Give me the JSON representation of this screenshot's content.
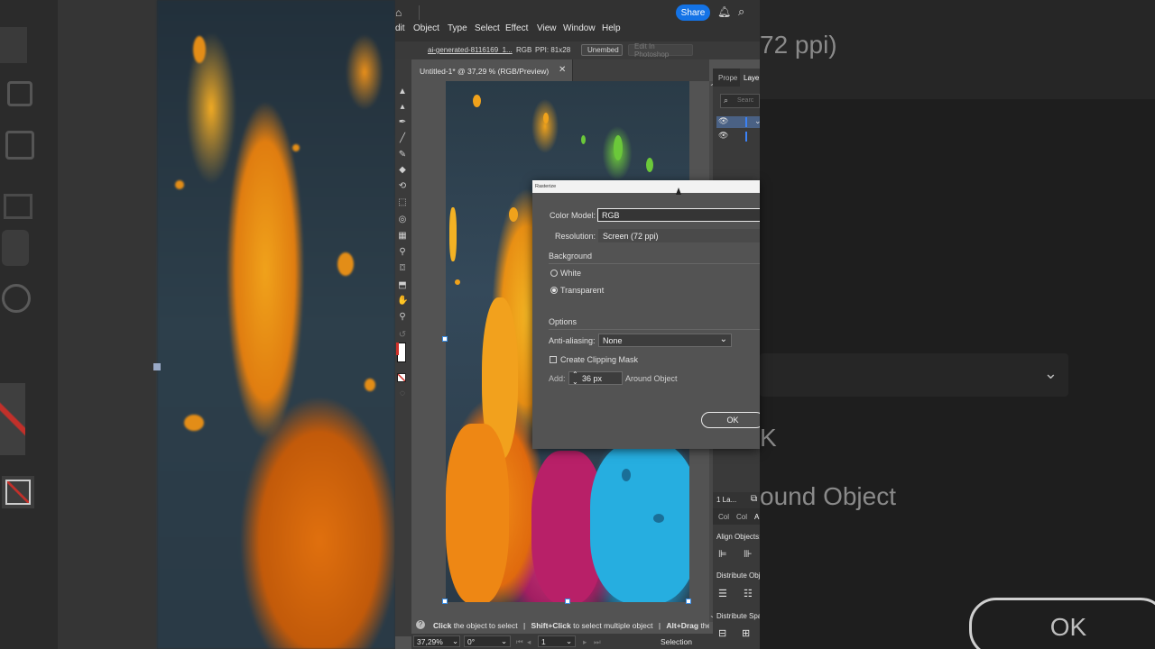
{
  "menu": {
    "items": [
      "dit",
      "Object",
      "Type",
      "Select",
      "Effect",
      "View",
      "Window",
      "Help"
    ],
    "share_label": "Share"
  },
  "control_bar": {
    "file_name": "ai-generated-8116169_1...",
    "color_mode": "RGB",
    "ppi": "PPI: 81x28",
    "unembed_label": "Unembed",
    "edit_photoshop_label": "Edit In Photoshop"
  },
  "document_tab": {
    "title": "Untitled-1* @ 37,29 % (RGB/Preview)",
    "close_glyph": "✕"
  },
  "status_hint": {
    "click": "Click",
    "click_rest": " the object to select",
    "sep1": "|",
    "shift": "Shift+Click",
    "shift_rest": " to select multiple object",
    "sep2": "|",
    "alt": "Alt+Drag",
    "alt_rest": " the obje"
  },
  "bottom_bar": {
    "zoom": "37,29%",
    "rotation": "0°",
    "artboard_number": "1",
    "tool_name": "Selection"
  },
  "right_panel": {
    "tab_properties": "Prope",
    "tab_layers": "Laye",
    "search_placeholder": "Searc",
    "layers_count": "1 La...",
    "subtab1": "Col",
    "subtab2": "Col",
    "subtab3": "A",
    "align_objects": "Align Objects:",
    "distribute_objects": "Distribute Obje",
    "distribute_spacing": "Distribute Spac"
  },
  "dialog": {
    "title": "Rasterize",
    "color_model_label": "Color Model:",
    "color_model_value": "RGB",
    "resolution_label": "Resolution:",
    "resolution_value": "Screen (72 ppi)",
    "background_heading": "Background",
    "white_label": "White",
    "transparent_label": "Transparent",
    "selected_background": "Transparent",
    "options_heading": "Options",
    "anti_aliasing_label": "Anti-aliasing:",
    "anti_aliasing_value": "None",
    "clipping_mask_label": "Create Clipping Mask",
    "clipping_mask_checked": false,
    "add_label": "Add:",
    "add_value": "36 px",
    "around_object_label": "Around Object",
    "ok_label": "OK"
  },
  "background_right": {
    "ppi_text": "72 ppi)",
    "around_text": "ound Object",
    "ok_text": "OK",
    "k_text": "K"
  }
}
